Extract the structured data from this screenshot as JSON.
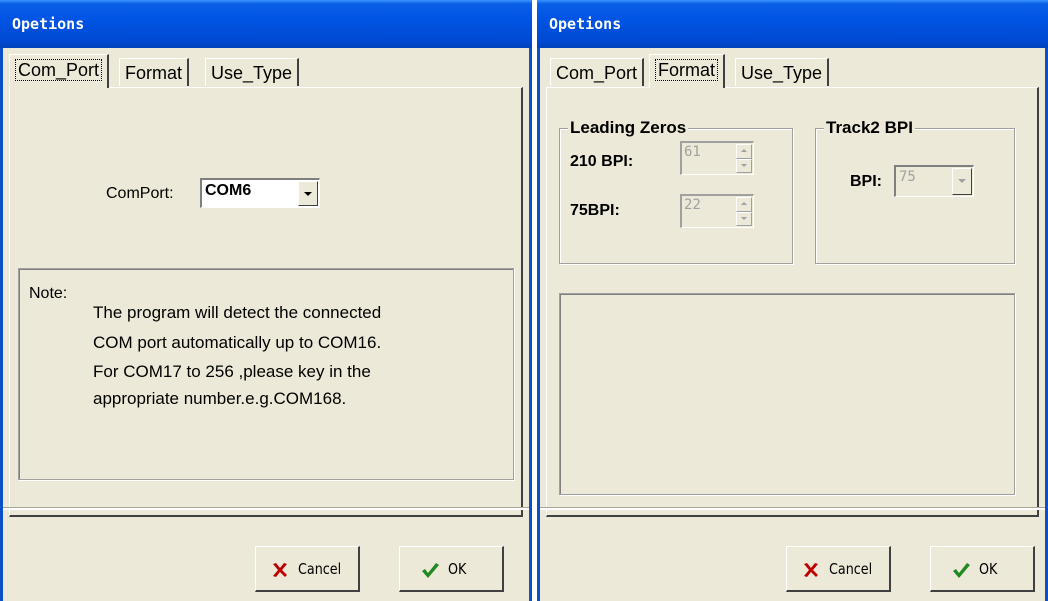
{
  "left": {
    "title": "Opetions",
    "tabs": [
      "Com_Port",
      "Format",
      "Use_Type"
    ],
    "active_tab": "Com_Port",
    "comport_label": "ComPort:",
    "comport_value": "COM6",
    "note_label": "Note:",
    "note_lines": [
      "The program will detect the connected",
      "COM port automatically up to COM16.",
      "For COM17 to 256 ,please key in the",
      "appropriate number.e.g.COM168."
    ],
    "cancel_label": "Cancel",
    "ok_label": "OK"
  },
  "right": {
    "title": "Opetions",
    "tabs": [
      "Com_Port",
      "Format",
      "Use_Type"
    ],
    "active_tab": "Format",
    "leading_zeros": {
      "title": "Leading Zeros",
      "bpi210_label": "210 BPI:",
      "bpi210_value": "61",
      "bpi75_label": "75BPI:",
      "bpi75_value": "22"
    },
    "track2": {
      "title": "Track2 BPI",
      "bpi_label": "BPI:",
      "bpi_value": "75"
    },
    "cancel_label": "Cancel",
    "ok_label": "OK"
  },
  "colors": {
    "titlebar": "#0054E3",
    "face": "#ECE9D8",
    "cancel_icon": "#C00000",
    "ok_icon": "#1F8A1F"
  }
}
